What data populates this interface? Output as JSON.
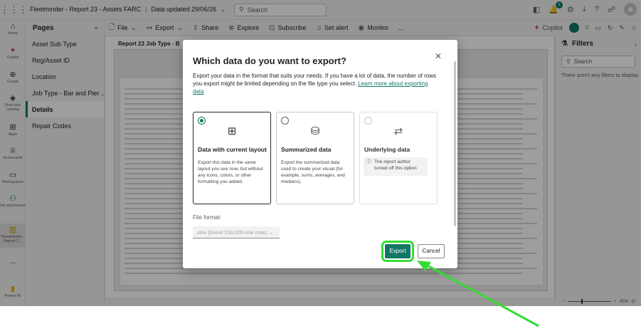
{
  "topbar": {
    "app_title": "Fleetminder - Report 23 - Assets FARC",
    "updated": "Data updated 29/06/26",
    "search_placeholder": "Search",
    "notification_count": "1"
  },
  "rail": {
    "items": [
      {
        "label": "Home",
        "icon": "home-icon"
      },
      {
        "label": "Copilot",
        "icon": "copilot-icon"
      },
      {
        "label": "Create",
        "icon": "plus-icon"
      },
      {
        "label": "OneLake catalog",
        "icon": "onelake-icon"
      },
      {
        "label": "Apps",
        "icon": "apps-icon"
      },
      {
        "label": "Scorecards",
        "icon": "trophy-icon"
      },
      {
        "label": "Workspaces",
        "icon": "workspaces-icon"
      },
      {
        "label": "My workspace",
        "icon": "person-icon"
      },
      {
        "label": "Fleetminder - Report 2...",
        "icon": "report-icon"
      },
      {
        "label": "...",
        "icon": "more-icon"
      },
      {
        "label": "Power BI",
        "icon": "powerbi-icon"
      }
    ]
  },
  "pages": {
    "header": "Pages",
    "items": [
      "Asset Sub Type",
      "Reg/Asset ID",
      "Location",
      "Job Type - Bar and Pier ...",
      "Details",
      "Repair Codes"
    ],
    "active_index": 4
  },
  "toolbar": {
    "file": "File",
    "export": "Export",
    "share": "Share",
    "explore": "Explore",
    "subscribe": "Subscribe",
    "set_alert": "Set alert",
    "monitor": "Monitor",
    "more": "...",
    "copilot": "Copilot"
  },
  "canvas": {
    "report_title": "Report 23 Job Type - B"
  },
  "filters": {
    "title": "Filters",
    "search_placeholder": "Search",
    "note": "There aren't any filters to display."
  },
  "status": {
    "zoom": "45%"
  },
  "dialog": {
    "title": "Which data do you want to export?",
    "description": "Export your data in the format that suits your needs. If you have a lot of data, the number of rows you export might be limited depending on the file type you select.",
    "link": "Learn more about exporting data",
    "options": [
      {
        "title": "Data with current layout",
        "description": "Export this data in the same layout you see now, but without any icons, colors, or other formatting you added.",
        "selected": true,
        "disabled": false,
        "icon": "table-icon"
      },
      {
        "title": "Summarized data",
        "description": "Export the summarized data used to create your visual (for example, sums, averages, and medians).",
        "selected": false,
        "disabled": false,
        "icon": "database-icon"
      },
      {
        "title": "Underlying data",
        "note": "The report author turned off this option",
        "selected": false,
        "disabled": true,
        "icon": "underlying-data-icon"
      }
    ],
    "file_format_label": "File format:",
    "file_format_value": ".xlsx (Excel 150,000-row max)",
    "export_button": "Export",
    "cancel_button": "Cancel"
  },
  "colors": {
    "accent": "#117865",
    "highlight": "#33dd33",
    "overlay": "rgba(0,0,0,0.38)"
  }
}
